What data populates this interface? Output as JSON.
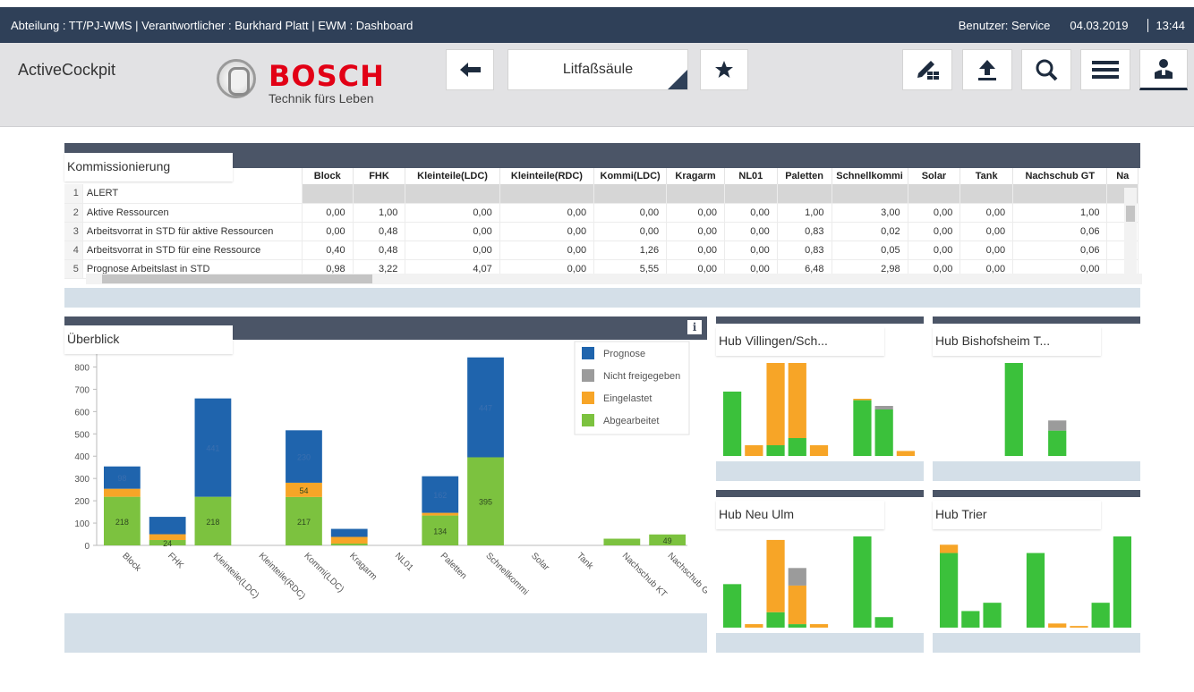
{
  "topbar": {
    "context": "Abteilung : TT/PJ-WMS | Verantwortlicher : Burkhard Platt | EWM : Dashboard",
    "user": "Benutzer: Service",
    "date": "04.03.2019",
    "time": "13:44"
  },
  "header": {
    "app_name": "ActiveCockpit",
    "brand": "BOSCH",
    "claim": "Technik fürs Leben",
    "current_view": "Litfaßsäule",
    "icons": [
      "back-arrow-icon",
      "star-icon",
      "edit-grid-icon",
      "upload-icon",
      "search-icon",
      "menu-icon",
      "user-icon"
    ]
  },
  "kommissionierung": {
    "title": "Kommissionierung",
    "columns": [
      "Block",
      "FHK",
      "Kleinteile(LDC)",
      "Kleinteile(RDC)",
      "Kommi(LDC)",
      "Kragarm",
      "NL01",
      "Paletten",
      "Schnellkommi",
      "Solar",
      "Tank",
      "Nachschub GT",
      "Na"
    ],
    "rows": [
      {
        "n": "1",
        "label": "ALERT",
        "values": [
          "",
          "",
          "",
          "",
          "",
          "",
          "",
          "",
          "",
          "",
          "",
          "",
          ""
        ]
      },
      {
        "n": "2",
        "label": "Aktive Ressourcen",
        "values": [
          "0,00",
          "1,00",
          "0,00",
          "0,00",
          "0,00",
          "0,00",
          "0,00",
          "1,00",
          "3,00",
          "0,00",
          "0,00",
          "1,00",
          ""
        ]
      },
      {
        "n": "3",
        "label": "Arbeitsvorrat in STD für aktive Ressourcen",
        "values": [
          "0,00",
          "0,48",
          "0,00",
          "0,00",
          "0,00",
          "0,00",
          "0,00",
          "0,83",
          "0,02",
          "0,00",
          "0,00",
          "0,06",
          ""
        ]
      },
      {
        "n": "4",
        "label": "Arbeitsvorrat in STD für eine Ressource",
        "values": [
          "0,40",
          "0,48",
          "0,00",
          "0,00",
          "1,26",
          "0,00",
          "0,00",
          "0,83",
          "0,05",
          "0,00",
          "0,00",
          "0,06",
          ""
        ]
      },
      {
        "n": "5",
        "label": "Prognose Arbeitslast in STD",
        "values": [
          "0,98",
          "3,22",
          "4,07",
          "0,00",
          "5,55",
          "0,00",
          "0,00",
          "6,48",
          "2,98",
          "0,00",
          "0,00",
          "0,00",
          ""
        ]
      }
    ]
  },
  "ueberblick": {
    "title": "Überblick",
    "info_label": "i"
  },
  "colors": {
    "prognose": "#1f64ad",
    "nicht_freigegeben": "#9b9b9b",
    "eingelastet": "#f7a527",
    "abgearbeitet": "#7cc23f",
    "hub_green": "#3bc13b",
    "hub_orange": "#f7a527"
  },
  "chart_data": [
    {
      "type": "bar",
      "stacked": true,
      "categories": [
        "Block",
        "FHK",
        "Kleinteile(LDC)",
        "Kleinteile(RDC)",
        "Kommi(LDC)",
        "Kragarm",
        "NL01",
        "Paletten",
        "Schnellkommi",
        "Solar",
        "Tank",
        "Nachschub KT",
        "Nachschub GT"
      ],
      "series": [
        {
          "name": "Abgearbeitet",
          "values": [
            218,
            24,
            218,
            0,
            217,
            8,
            0,
            134,
            395,
            0,
            0,
            30,
            49
          ]
        },
        {
          "name": "Eingelastet",
          "values": [
            36,
            26,
            0,
            0,
            64,
            30,
            0,
            12,
            0,
            0,
            0,
            0,
            0
          ]
        },
        {
          "name": "Nicht freigegeben",
          "values": [
            0,
            0,
            0,
            0,
            0,
            0,
            0,
            0,
            0,
            0,
            0,
            0,
            0
          ]
        },
        {
          "name": "Prognose",
          "values": [
            100,
            78,
            441,
            0,
            235,
            36,
            0,
            164,
            448,
            0,
            0,
            0,
            0
          ]
        }
      ],
      "bar_labels": {
        "Abgearbeitet": [
          "218",
          "24",
          "218",
          "",
          "217",
          "",
          "",
          "134",
          "395",
          "",
          "",
          "",
          "49"
        ],
        "Eingelastet": [
          "",
          "",
          "",
          "",
          "54",
          "",
          "",
          "",
          "",
          "",
          "",
          "",
          ""
        ],
        "Prognose": [
          "98",
          "",
          "441",
          "",
          "230",
          "",
          "",
          "162",
          "447",
          "",
          "",
          "",
          ""
        ]
      },
      "ylim": [
        0,
        850
      ],
      "yticks": [
        0,
        100,
        200,
        300,
        400,
        500,
        600,
        700,
        800
      ],
      "legend": [
        "Prognose",
        "Nicht freigegeben",
        "Eingelastet",
        "Abgearbeitet"
      ],
      "legend_position": "top-right"
    },
    {
      "type": "bar",
      "title": "Hub Villingen/Sch...",
      "bars": [
        [
          {
            "color": "green",
            "value": 90
          }
        ],
        [
          {
            "color": "orange",
            "value": 15
          }
        ],
        [
          {
            "color": "green",
            "value": 15
          },
          {
            "color": "orange",
            "value": 115
          }
        ],
        [
          {
            "color": "green",
            "value": 25
          },
          {
            "color": "orange",
            "value": 105
          }
        ],
        [
          {
            "color": "orange",
            "value": 15
          }
        ],
        [],
        [
          {
            "color": "green",
            "value": 78
          },
          {
            "color": "orange",
            "value": 2
          }
        ],
        [
          {
            "color": "green",
            "value": 65
          },
          {
            "color": "gray",
            "value": 5
          }
        ],
        [
          {
            "color": "orange",
            "value": 7
          }
        ]
      ],
      "ylim": [
        0,
        130
      ]
    },
    {
      "type": "bar",
      "title": "Hub Bishofsheim T...",
      "bars": [
        [],
        [],
        [],
        [
          {
            "color": "green",
            "value": 110
          }
        ],
        [],
        [
          {
            "color": "green",
            "value": 30
          },
          {
            "color": "gray",
            "value": 12
          }
        ],
        [],
        [],
        []
      ],
      "ylim": [
        0,
        110
      ]
    },
    {
      "type": "bar",
      "title": "Hub Neu Ulm",
      "bars": [
        [
          {
            "color": "green",
            "value": 62
          }
        ],
        [
          {
            "color": "orange",
            "value": 5
          }
        ],
        [
          {
            "color": "green",
            "value": 22
          },
          {
            "color": "orange",
            "value": 103
          }
        ],
        [
          {
            "color": "green",
            "value": 5
          },
          {
            "color": "orange",
            "value": 55
          },
          {
            "color": "gray",
            "value": 25
          }
        ],
        [
          {
            "color": "orange",
            "value": 5
          }
        ],
        [],
        [
          {
            "color": "green",
            "value": 130
          }
        ],
        [
          {
            "color": "green",
            "value": 15
          }
        ],
        []
      ],
      "ylim": [
        0,
        130
      ]
    },
    {
      "type": "bar",
      "title": "Hub Trier",
      "bars": [
        [
          {
            "color": "green",
            "value": 90
          },
          {
            "color": "orange",
            "value": 10
          }
        ],
        [
          {
            "color": "green",
            "value": 20
          }
        ],
        [
          {
            "color": "green",
            "value": 30
          }
        ],
        [],
        [
          {
            "color": "green",
            "value": 90
          }
        ],
        [
          {
            "color": "orange",
            "value": 5
          }
        ],
        [
          {
            "color": "orange",
            "value": 2
          }
        ],
        [
          {
            "color": "green",
            "value": 30
          }
        ],
        [
          {
            "color": "green",
            "value": 110
          }
        ]
      ],
      "ylim": [
        0,
        110
      ]
    }
  ]
}
